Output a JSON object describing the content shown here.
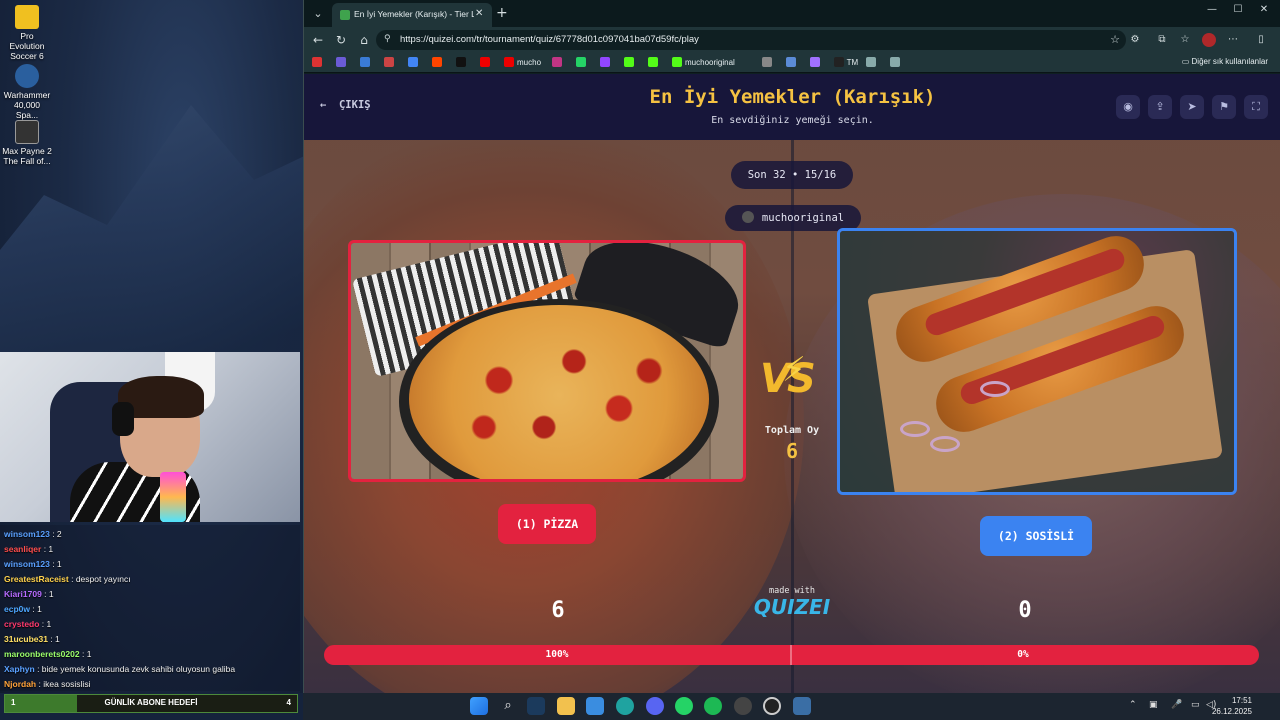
{
  "desktop": {
    "icons": [
      {
        "label": "Pro Evolution Soccer 6",
        "color": "#f0c020"
      },
      {
        "label": "Warhammer 40,000 Spa...",
        "color": "#2a5f9e"
      },
      {
        "label": "Max Payne 2 The Fall of...",
        "color": "#333333"
      }
    ]
  },
  "chat": {
    "lines": [
      {
        "user": "winsom123",
        "sep": " : ",
        "msg": "2",
        "color": "#5aa0ff"
      },
      {
        "user": "seanliqer",
        "sep": " : ",
        "msg": "1",
        "color": "#ff4d4d"
      },
      {
        "user": "winsom123",
        "sep": " : ",
        "msg": "1",
        "color": "#5aa0ff"
      },
      {
        "user": "GreatestRaceist",
        "sep": " : ",
        "msg": "despot yayıncı",
        "color": "#ffd24d"
      },
      {
        "user": "Kiari1709",
        "sep": " : ",
        "msg": "1",
        "color": "#b66bff"
      },
      {
        "user": "ecp0w",
        "sep": " : ",
        "msg": "1",
        "color": "#4da6ff"
      },
      {
        "user": "crystedo",
        "sep": " : ",
        "msg": "1",
        "color": "#ff3a6d"
      },
      {
        "user": "31ucube31",
        "sep": " : ",
        "msg": "1",
        "color": "#ffe066"
      },
      {
        "user": "maroonberets0202",
        "sep": " : ",
        "msg": "1",
        "color": "#9cff6b"
      },
      {
        "user": "Xaphyn",
        "sep": " : ",
        "msg": "bide yemek konusunda zevk sahibi oluyosun galiba",
        "color": "#5aa0ff"
      },
      {
        "user": "Njordah",
        "sep": " : ",
        "msg": "ikea sosislisi",
        "color": "#ffa23a"
      }
    ]
  },
  "subgoal": {
    "current": "1",
    "title": "GÜNLİK ABONE HEDEFİ",
    "goal": "4"
  },
  "browser": {
    "tab_title": "En İyi Yemekler (Karışık) - Tier List",
    "url": "https://quizei.com/tr/tournament/quiz/67778d01c097041ba07d59fc/play",
    "bookmarks": [
      {
        "label": "",
        "color": "#d33"
      },
      {
        "label": "",
        "color": "#6b5bd6"
      },
      {
        "label": "",
        "color": "#3a7bd5"
      },
      {
        "label": "",
        "color": "#c44"
      },
      {
        "label": "",
        "color": "#4285f4"
      },
      {
        "label": "",
        "color": "#ff4500"
      },
      {
        "label": "",
        "color": "#111"
      },
      {
        "label": "",
        "color": "#e00"
      },
      {
        "label": "mucho",
        "color": "#e00"
      },
      {
        "label": "",
        "color": "#c13584"
      },
      {
        "label": "",
        "color": "#25d366"
      },
      {
        "label": "",
        "color": "#9146ff"
      },
      {
        "label": "",
        "color": "#53fc18"
      },
      {
        "label": "",
        "color": "#53fc18"
      },
      {
        "label": "muchooriginal",
        "color": "#53fc18"
      },
      {
        "label": "",
        "color": "#888"
      },
      {
        "label": "",
        "color": "#5b8bd6"
      },
      {
        "label": "",
        "color": "#a070ff"
      },
      {
        "label": "TM",
        "color": "#222"
      },
      {
        "label": "",
        "color": "#8aa"
      },
      {
        "label": "",
        "color": "#8aa"
      }
    ],
    "other_bookmarks": "Diğer sık kullanılanlar"
  },
  "quiz": {
    "back": "ÇIKIŞ",
    "title": "En İyi Yemekler (Karışık)",
    "subtitle": "En sevdiğiniz yemeği seçin.",
    "round": "Son 32 • 15/16",
    "author": "muchooriginal",
    "vs": "VS",
    "total_label": "Toplam Oy",
    "total": "6",
    "left": {
      "button": "(1) PİZZA",
      "votes": "6",
      "percent": "100%",
      "color": "#e3223f"
    },
    "right": {
      "button": "(2) SOSİSLİ",
      "votes": "0",
      "percent": "0%",
      "color": "#3b83f1"
    },
    "made_with": "made with",
    "logo": "QUIZEI"
  },
  "taskbar": {
    "time": "17:51",
    "date": "26.12.2025"
  }
}
